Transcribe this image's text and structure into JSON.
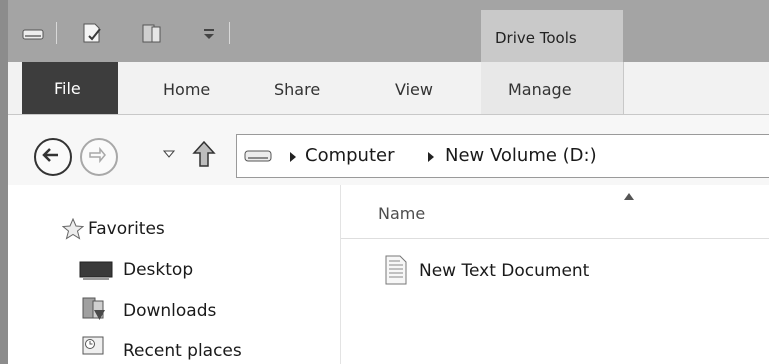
{
  "titlebar": {
    "contextual_tab_group": "Drive Tools",
    "icons": [
      "drive-icon",
      "properties-icon",
      "new-folder-icon",
      "customize-qat-icon"
    ]
  },
  "ribbon": {
    "tabs": [
      "File",
      "Home",
      "Share",
      "View",
      "Manage"
    ]
  },
  "address_bar": {
    "breadcrumbs": [
      "Computer",
      "New Volume (D:)"
    ],
    "icons": [
      "back-icon",
      "forward-icon",
      "recent-locations-icon",
      "up-icon",
      "drive-icon"
    ]
  },
  "nav_pane": {
    "favorites_label": "Favorites",
    "items": [
      "Desktop",
      "Downloads",
      "Recent places"
    ]
  },
  "file_list": {
    "column_name": "Name",
    "sort": "ascending",
    "files": [
      {
        "name": "New Text Document",
        "icon": "text-document-icon"
      }
    ]
  },
  "colors": {
    "titlebar_bg": "#a4a4a4",
    "contextual_tab_bg": "#c9c9c9",
    "file_tab_bg": "#3d3d3d",
    "ribbon_bg": "#f2f2f2"
  }
}
